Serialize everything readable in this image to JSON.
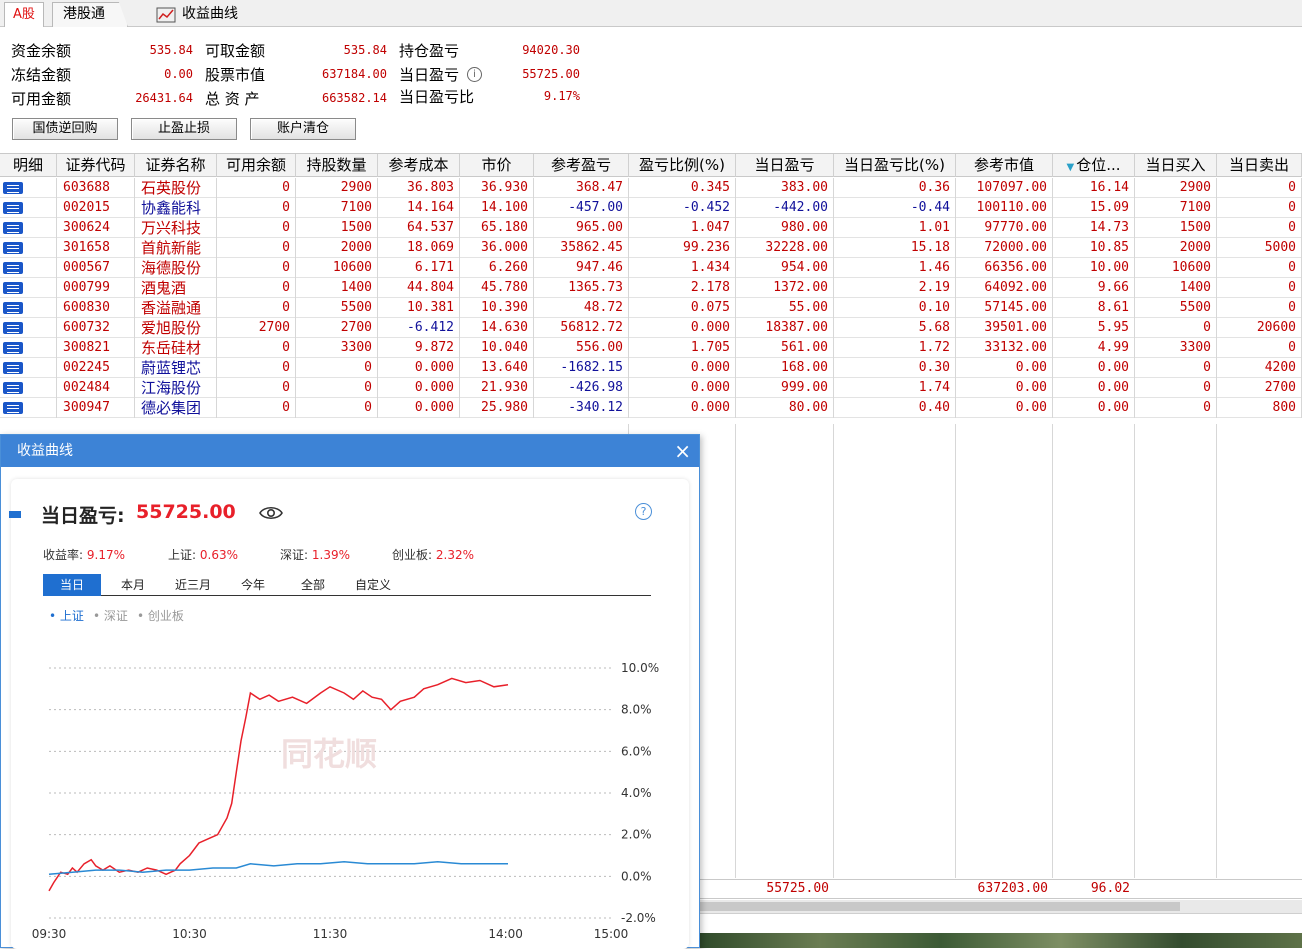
{
  "tabs": {
    "a_share": "A股",
    "hk_connect": "港股通",
    "curve": "收益曲线"
  },
  "summary": {
    "cash_balance_label": "资金余额",
    "cash_balance": "535.84",
    "withdrawable_label": "可取金额",
    "withdrawable": "535.84",
    "position_pl_label": "持仓盈亏",
    "position_pl": "94020.30",
    "frozen_label": "冻结金额",
    "frozen": "0.00",
    "stock_value_label": "股票市值",
    "stock_value": "637184.00",
    "today_pl_label": "当日盈亏",
    "today_pl": "55725.00",
    "available_label": "可用金额",
    "available": "26431.64",
    "total_assets_label": "总 资 产",
    "total_assets": "663582.14",
    "today_pl_ratio_label": "当日盈亏比",
    "today_pl_ratio": "9.17%"
  },
  "buttons": {
    "repo": "国债逆回购",
    "stop": "止盈止损",
    "clear": "账户清仓"
  },
  "columns": [
    "明细",
    "证券代码",
    "证券名称",
    "可用余额",
    "持股数量",
    "参考成本",
    "市价",
    "参考盈亏",
    "盈亏比例(%)",
    "当日盈亏",
    "当日盈亏比(%)",
    "参考市值",
    "仓位...",
    "当日买入",
    "当日卖出"
  ],
  "rows": [
    [
      "603688",
      "石英股份",
      "0",
      "2900",
      "36.803",
      "36.930",
      "368.47",
      "0.345",
      "383.00",
      "0.36",
      "107097.00",
      "16.14",
      "2900",
      "0"
    ],
    [
      "002015",
      "协鑫能科",
      "0",
      "7100",
      "14.164",
      "14.100",
      "-457.00",
      "-0.452",
      "-442.00",
      "-0.44",
      "100110.00",
      "15.09",
      "7100",
      "0"
    ],
    [
      "300624",
      "万兴科技",
      "0",
      "1500",
      "64.537",
      "65.180",
      "965.00",
      "1.047",
      "980.00",
      "1.01",
      "97770.00",
      "14.73",
      "1500",
      "0"
    ],
    [
      "301658",
      "首航新能",
      "0",
      "2000",
      "18.069",
      "36.000",
      "35862.45",
      "99.236",
      "32228.00",
      "15.18",
      "72000.00",
      "10.85",
      "2000",
      "5000"
    ],
    [
      "000567",
      "海德股份",
      "0",
      "10600",
      "6.171",
      "6.260",
      "947.46",
      "1.434",
      "954.00",
      "1.46",
      "66356.00",
      "10.00",
      "10600",
      "0"
    ],
    [
      "000799",
      "酒鬼酒",
      "0",
      "1400",
      "44.804",
      "45.780",
      "1365.73",
      "2.178",
      "1372.00",
      "2.19",
      "64092.00",
      "9.66",
      "1400",
      "0"
    ],
    [
      "600830",
      "香溢融通",
      "0",
      "5500",
      "10.381",
      "10.390",
      "48.72",
      "0.075",
      "55.00",
      "0.10",
      "57145.00",
      "8.61",
      "5500",
      "0"
    ],
    [
      "600732",
      "爱旭股份",
      "2700",
      "2700",
      "-6.412",
      "14.630",
      "56812.72",
      "0.000",
      "18387.00",
      "5.68",
      "39501.00",
      "5.95",
      "0",
      "20600"
    ],
    [
      "300821",
      "东岳硅材",
      "0",
      "3300",
      "9.872",
      "10.040",
      "556.00",
      "1.705",
      "561.00",
      "1.72",
      "33132.00",
      "4.99",
      "3300",
      "0"
    ],
    [
      "002245",
      "蔚蓝锂芯",
      "0",
      "0",
      "0.000",
      "13.640",
      "-1682.15",
      "0.000",
      "168.00",
      "0.30",
      "0.00",
      "0.00",
      "0",
      "4200"
    ],
    [
      "002484",
      "江海股份",
      "0",
      "0",
      "0.000",
      "21.930",
      "-426.98",
      "0.000",
      "999.00",
      "1.74",
      "0.00",
      "0.00",
      "0",
      "2700"
    ],
    [
      "300947",
      "德必集团",
      "0",
      "0",
      "0.000",
      "25.980",
      "-340.12",
      "0.000",
      "80.00",
      "0.40",
      "0.00",
      "0.00",
      "0",
      "800"
    ]
  ],
  "totals": {
    "today_pl": "55725.00",
    "market_value": "637203.00",
    "position": "96.02"
  },
  "popup": {
    "title": "收益曲线",
    "close": "×",
    "pl_label": "当日盈亏:",
    "pl_value": "55725.00",
    "return_label": "收益率:",
    "return_value": "9.17%",
    "sh_label": "上证:",
    "sh_value": "0.63%",
    "sz_label": "深证:",
    "sz_value": "1.39%",
    "cyb_label": "创业板:",
    "cyb_value": "2.32%",
    "ranges": [
      "当日",
      "本月",
      "近三月",
      "今年",
      "全部",
      "自定义"
    ],
    "legend": [
      "• 上证",
      "• 深证",
      "• 创业板"
    ],
    "watermark": "同花顺",
    "help": "?"
  },
  "chart_data": {
    "type": "line",
    "x_ticks": [
      "09:30",
      "10:30",
      "11:30",
      "14:00",
      "15:00"
    ],
    "y_ticks": [
      "10.0%",
      "8.0%",
      "6.0%",
      "4.0%",
      "2.0%",
      "0.0%",
      "-2.0%"
    ],
    "ylim": [
      -2.0,
      10.0
    ],
    "series": [
      {
        "color": "#e8202a",
        "points": [
          [
            0,
            -0.7
          ],
          [
            2,
            -0.3
          ],
          [
            5,
            0.2
          ],
          [
            8,
            0.1
          ],
          [
            10,
            0.4
          ],
          [
            12,
            0.2
          ],
          [
            15,
            0.6
          ],
          [
            18,
            0.8
          ],
          [
            20,
            0.5
          ],
          [
            23,
            0.3
          ],
          [
            26,
            0.5
          ],
          [
            30,
            0.2
          ],
          [
            34,
            0.3
          ],
          [
            38,
            0.2
          ],
          [
            42,
            0.4
          ],
          [
            46,
            0.3
          ],
          [
            50,
            0.1
          ],
          [
            54,
            0.3
          ],
          [
            56,
            0.6
          ],
          [
            60,
            1.0
          ],
          [
            64,
            1.6
          ],
          [
            68,
            1.8
          ],
          [
            72,
            2.0
          ],
          [
            76,
            2.8
          ],
          [
            78,
            3.5
          ],
          [
            80,
            5.0
          ],
          [
            82,
            6.5
          ],
          [
            84,
            7.6
          ],
          [
            86,
            8.8
          ],
          [
            90,
            8.5
          ],
          [
            94,
            8.7
          ],
          [
            98,
            8.4
          ],
          [
            104,
            8.6
          ],
          [
            110,
            8.3
          ],
          [
            116,
            8.8
          ],
          [
            120,
            9.1
          ],
          [
            126,
            8.8
          ],
          [
            130,
            8.5
          ],
          [
            134,
            8.9
          ],
          [
            138,
            8.6
          ],
          [
            142,
            8.5
          ],
          [
            146,
            8.0
          ],
          [
            150,
            8.4
          ],
          [
            156,
            8.6
          ],
          [
            160,
            9.0
          ],
          [
            166,
            9.2
          ],
          [
            172,
            9.5
          ],
          [
            178,
            9.3
          ],
          [
            184,
            9.4
          ],
          [
            190,
            9.1
          ],
          [
            196,
            9.2
          ]
        ]
      },
      {
        "color": "#2a8ad4",
        "points": [
          [
            0,
            0.1
          ],
          [
            10,
            0.2
          ],
          [
            20,
            0.3
          ],
          [
            30,
            0.3
          ],
          [
            40,
            0.2
          ],
          [
            50,
            0.3
          ],
          [
            60,
            0.3
          ],
          [
            70,
            0.4
          ],
          [
            80,
            0.4
          ],
          [
            86,
            0.6
          ],
          [
            96,
            0.5
          ],
          [
            106,
            0.6
          ],
          [
            116,
            0.6
          ],
          [
            126,
            0.7
          ],
          [
            136,
            0.6
          ],
          [
            146,
            0.6
          ],
          [
            156,
            0.6
          ],
          [
            166,
            0.7
          ],
          [
            176,
            0.6
          ],
          [
            186,
            0.6
          ],
          [
            196,
            0.6
          ]
        ]
      }
    ],
    "x_max": 240
  }
}
